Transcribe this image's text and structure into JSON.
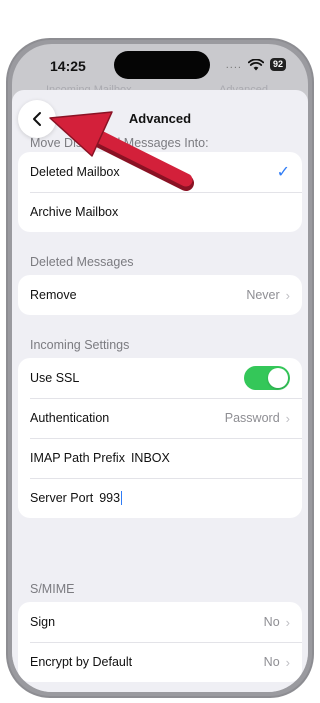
{
  "status": {
    "time": "14:25",
    "dots": "....",
    "battery": "92"
  },
  "ghost": {
    "left": "Incoming Mailbox",
    "right": "Advanced"
  },
  "nav": {
    "title": "Advanced"
  },
  "sections": {
    "move": {
      "header": "Move Discarded Messages Into:"
    },
    "deleted": {
      "header": "Deleted Messages"
    },
    "incoming": {
      "header": "Incoming Settings"
    },
    "smime": {
      "header": "S/MIME"
    }
  },
  "rows": {
    "deleted_mailbox": {
      "label": "Deleted Mailbox",
      "check": "✓"
    },
    "archive_mailbox": {
      "label": "Archive Mailbox"
    },
    "remove": {
      "label": "Remove",
      "value": "Never"
    },
    "use_ssl": {
      "label": "Use SSL",
      "state": "on"
    },
    "authentication": {
      "label": "Authentication",
      "value": "Password"
    },
    "imap_prefix": {
      "label": "IMAP Path Prefix",
      "value": "INBOX"
    },
    "server_port": {
      "label": "Server Port",
      "value": "993"
    },
    "sign": {
      "label": "Sign",
      "value": "No"
    },
    "encrypt": {
      "label": "Encrypt by Default",
      "value": "No"
    }
  },
  "colors": {
    "accent": "#2f7cf6",
    "toggle_on": "#34c759",
    "annotation_arrow": "#d3203a"
  },
  "icons": {
    "back": "chevron-left-icon",
    "chevron": "chevron-right-icon",
    "check": "checkmark-icon"
  }
}
